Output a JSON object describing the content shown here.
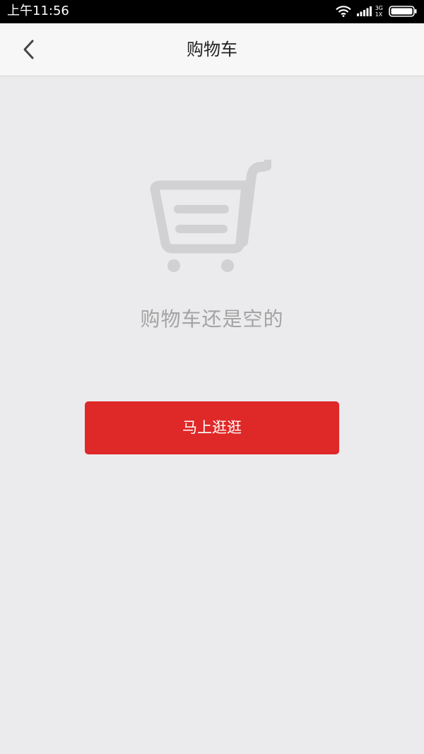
{
  "status_bar": {
    "time": "上午11:56",
    "net_type_top": "3G",
    "net_type_bottom": "1X",
    "icons": [
      "wifi-icon",
      "signal-icon",
      "battery-icon"
    ]
  },
  "header": {
    "title": "购物车",
    "back_icon": "chevron-left-icon"
  },
  "empty_state": {
    "icon": "shopping-cart-icon",
    "message": "购物车还是空的",
    "button_label": "马上逛逛"
  },
  "colors": {
    "background": "#ebebed",
    "accent": "#df2828",
    "header_bg": "#f7f7f7",
    "muted_text": "#a3a3a3",
    "illustration": "#d1d1d3"
  }
}
